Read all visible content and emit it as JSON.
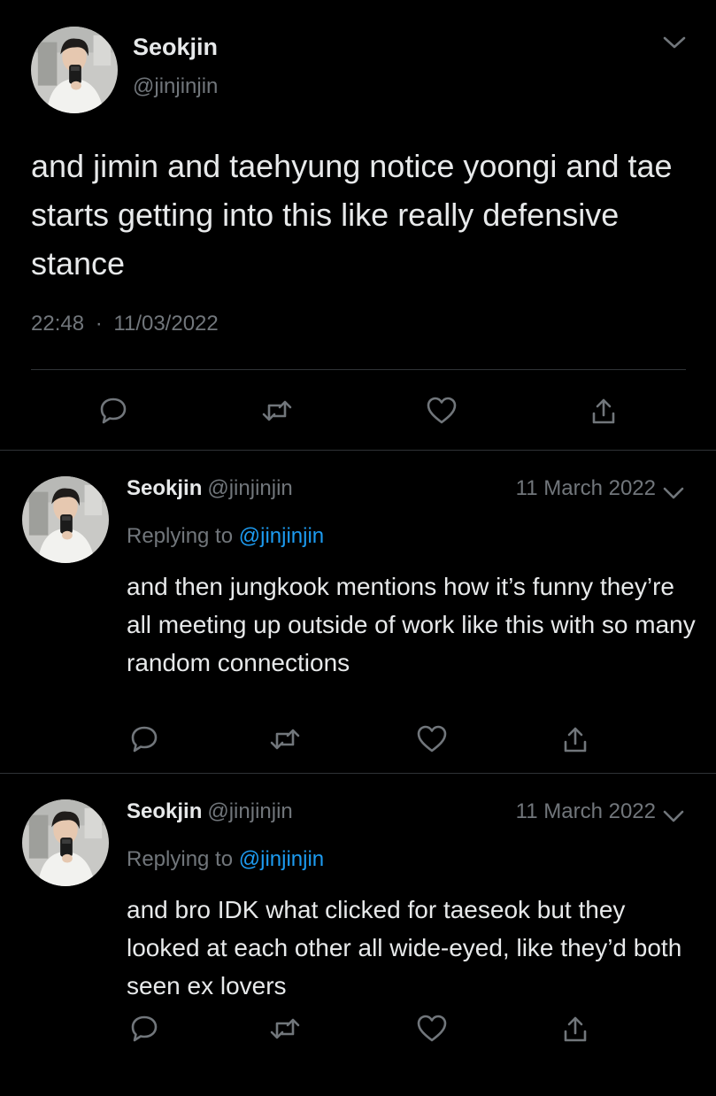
{
  "main_tweet": {
    "name": "Seokjin",
    "handle": "@jinjinjin",
    "text": "and jimin and taehyung notice yoongi and tae starts getting into this like really defensive stance",
    "time": "22:48",
    "separator": "·",
    "date": "11/03/2022"
  },
  "replies": [
    {
      "name": "Seokjin",
      "handle": "@jinjinjin",
      "date": "11 March 2022",
      "replying_prefix": "Replying to",
      "replying_to": "@jinjinjin",
      "text": "and then jungkook mentions how it’s funny they’re all meeting up outside of work like this with so many random connections"
    },
    {
      "name": "Seokjin",
      "handle": "@jinjinjin",
      "date": "11 March 2022",
      "replying_prefix": "Replying to",
      "replying_to": "@jinjinjin",
      "text": "and bro IDK what clicked for taeseok but they looked at each other all wide-eyed, like they’d both seen ex lovers"
    }
  ],
  "icons": {
    "reply": "reply-icon",
    "retweet": "retweet-icon",
    "like": "like-icon",
    "share": "share-icon",
    "more": "chevron-down-icon",
    "avatar": "avatar"
  },
  "colors": {
    "background": "#000000",
    "primary_text": "#e7e9ea",
    "secondary_text": "#71767b",
    "link": "#1d9bf0",
    "divider": "#2f3336"
  }
}
